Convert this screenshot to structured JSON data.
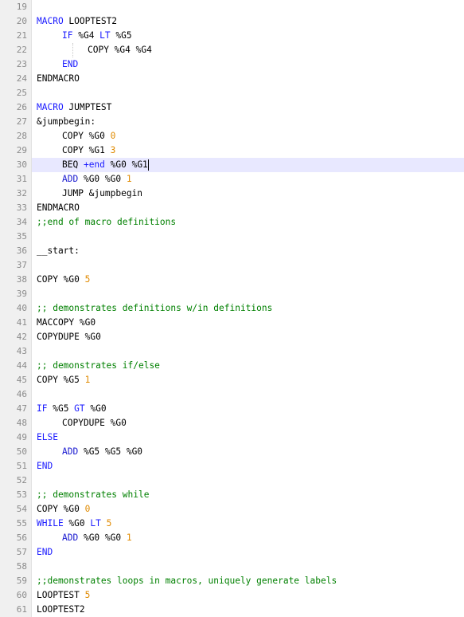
{
  "editor": {
    "lines": [
      {
        "n": "19",
        "indent": 0,
        "tokens": []
      },
      {
        "n": "20",
        "indent": 0,
        "tokens": [
          {
            "t": "MACRO",
            "c": "kw"
          },
          {
            "t": " LOOPTEST2",
            "c": "plain"
          }
        ]
      },
      {
        "n": "21",
        "indent": 1,
        "tokens": [
          {
            "t": "IF",
            "c": "kw"
          },
          {
            "t": " %G4 ",
            "c": "plain"
          },
          {
            "t": "LT",
            "c": "kw"
          },
          {
            "t": " %G5",
            "c": "plain"
          }
        ]
      },
      {
        "n": "22",
        "indent": 2,
        "tokens": [
          {
            "t": "COPY %G4 %G4",
            "c": "plain"
          }
        ]
      },
      {
        "n": "23",
        "indent": 1,
        "tokens": [
          {
            "t": "END",
            "c": "kw"
          }
        ]
      },
      {
        "n": "24",
        "indent": 0,
        "tokens": [
          {
            "t": "ENDMACRO",
            "c": "plain"
          }
        ]
      },
      {
        "n": "25",
        "indent": 0,
        "tokens": []
      },
      {
        "n": "26",
        "indent": 0,
        "tokens": [
          {
            "t": "MACRO",
            "c": "kw"
          },
          {
            "t": " JUMPTEST",
            "c": "plain"
          }
        ]
      },
      {
        "n": "27",
        "indent": 0,
        "tokens": [
          {
            "t": "&jumpbegin:",
            "c": "plain"
          }
        ]
      },
      {
        "n": "28",
        "indent": 1,
        "tokens": [
          {
            "t": "COPY %G0 ",
            "c": "plain"
          },
          {
            "t": "0",
            "c": "num"
          }
        ]
      },
      {
        "n": "29",
        "indent": 1,
        "tokens": [
          {
            "t": "COPY %G1 ",
            "c": "plain"
          },
          {
            "t": "3",
            "c": "num"
          }
        ]
      },
      {
        "n": "30",
        "indent": 1,
        "active": true,
        "tokens": [
          {
            "t": "BEQ ",
            "c": "plain"
          },
          {
            "t": "+end",
            "c": "kw"
          },
          {
            "t": " %G0 %G1",
            "c": "plain"
          }
        ]
      },
      {
        "n": "31",
        "indent": 1,
        "tokens": [
          {
            "t": "ADD",
            "c": "kw2"
          },
          {
            "t": " %G0 %G0 ",
            "c": "plain"
          },
          {
            "t": "1",
            "c": "num"
          }
        ]
      },
      {
        "n": "32",
        "indent": 1,
        "tokens": [
          {
            "t": "JUMP &jumpbegin",
            "c": "plain"
          }
        ]
      },
      {
        "n": "33",
        "indent": 0,
        "tokens": [
          {
            "t": "ENDMACRO",
            "c": "plain"
          }
        ]
      },
      {
        "n": "34",
        "indent": 0,
        "tokens": [
          {
            "t": ";;end of macro definitions",
            "c": "cmt"
          }
        ]
      },
      {
        "n": "35",
        "indent": 0,
        "tokens": []
      },
      {
        "n": "36",
        "indent": 0,
        "tokens": [
          {
            "t": "__start:",
            "c": "plain"
          }
        ]
      },
      {
        "n": "37",
        "indent": 0,
        "tokens": []
      },
      {
        "n": "38",
        "indent": 0,
        "tokens": [
          {
            "t": "COPY %G0 ",
            "c": "plain"
          },
          {
            "t": "5",
            "c": "num"
          }
        ]
      },
      {
        "n": "39",
        "indent": 0,
        "tokens": []
      },
      {
        "n": "40",
        "indent": 0,
        "tokens": [
          {
            "t": ";; demonstrates definitions w/in definitions",
            "c": "cmt"
          }
        ]
      },
      {
        "n": "41",
        "indent": 0,
        "tokens": [
          {
            "t": "MACCOPY %G0",
            "c": "plain"
          }
        ]
      },
      {
        "n": "42",
        "indent": 0,
        "tokens": [
          {
            "t": "COPYDUPE %G0",
            "c": "plain"
          }
        ]
      },
      {
        "n": "43",
        "indent": 0,
        "tokens": []
      },
      {
        "n": "44",
        "indent": 0,
        "tokens": [
          {
            "t": ";; demonstrates if/else",
            "c": "cmt"
          }
        ]
      },
      {
        "n": "45",
        "indent": 0,
        "tokens": [
          {
            "t": "COPY %G5 ",
            "c": "plain"
          },
          {
            "t": "1",
            "c": "num"
          }
        ]
      },
      {
        "n": "46",
        "indent": 0,
        "tokens": []
      },
      {
        "n": "47",
        "indent": 0,
        "tokens": [
          {
            "t": "IF",
            "c": "kw"
          },
          {
            "t": " %G5 ",
            "c": "plain"
          },
          {
            "t": "GT",
            "c": "kw"
          },
          {
            "t": " %G0",
            "c": "plain"
          }
        ]
      },
      {
        "n": "48",
        "indent": 1,
        "tokens": [
          {
            "t": "COPYDUPE %G0",
            "c": "plain"
          }
        ]
      },
      {
        "n": "49",
        "indent": 0,
        "tokens": [
          {
            "t": "ELSE",
            "c": "kw"
          }
        ]
      },
      {
        "n": "50",
        "indent": 1,
        "tokens": [
          {
            "t": "ADD",
            "c": "kw2"
          },
          {
            "t": " %G5 %G5 %G0",
            "c": "plain"
          }
        ]
      },
      {
        "n": "51",
        "indent": 0,
        "tokens": [
          {
            "t": "END",
            "c": "kw"
          }
        ]
      },
      {
        "n": "52",
        "indent": 0,
        "tokens": []
      },
      {
        "n": "53",
        "indent": 0,
        "tokens": [
          {
            "t": ";; demonstrates while",
            "c": "cmt"
          }
        ]
      },
      {
        "n": "54",
        "indent": 0,
        "tokens": [
          {
            "t": "COPY %G0 ",
            "c": "plain"
          },
          {
            "t": "0",
            "c": "num"
          }
        ]
      },
      {
        "n": "55",
        "indent": 0,
        "tokens": [
          {
            "t": "WHILE",
            "c": "kw"
          },
          {
            "t": " %G0 ",
            "c": "plain"
          },
          {
            "t": "LT",
            "c": "kw"
          },
          {
            "t": " ",
            "c": "plain"
          },
          {
            "t": "5",
            "c": "num"
          }
        ]
      },
      {
        "n": "56",
        "indent": 1,
        "tokens": [
          {
            "t": "ADD",
            "c": "kw2"
          },
          {
            "t": " %G0 %G0 ",
            "c": "plain"
          },
          {
            "t": "1",
            "c": "num"
          }
        ]
      },
      {
        "n": "57",
        "indent": 0,
        "tokens": [
          {
            "t": "END",
            "c": "kw"
          }
        ]
      },
      {
        "n": "58",
        "indent": 0,
        "tokens": []
      },
      {
        "n": "59",
        "indent": 0,
        "tokens": [
          {
            "t": ";;demonstrates loops in macros, uniquely generate labels",
            "c": "cmt"
          }
        ]
      },
      {
        "n": "60",
        "indent": 0,
        "tokens": [
          {
            "t": "LOOPTEST ",
            "c": "plain"
          },
          {
            "t": "5",
            "c": "num"
          }
        ]
      },
      {
        "n": "61",
        "indent": 0,
        "tokens": [
          {
            "t": "LOOPTEST2",
            "c": "plain"
          }
        ]
      }
    ]
  }
}
